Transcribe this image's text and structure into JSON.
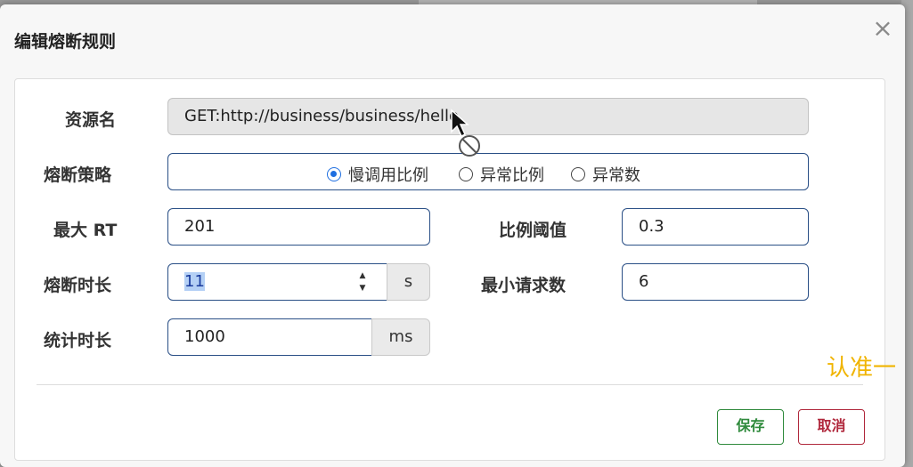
{
  "dialog": {
    "title": "编辑熔断规则",
    "close_symbol": "×"
  },
  "form": {
    "resource_label": "资源名",
    "resource_value": "GET:http://business/business/hello",
    "strategy_label": "熔断策略",
    "strategy_options": [
      {
        "label": "慢调用比例",
        "selected": true
      },
      {
        "label": "异常比例",
        "selected": false
      },
      {
        "label": "异常数",
        "selected": false
      }
    ],
    "max_rt_label": "最大 RT",
    "max_rt_value": "201",
    "ratio_threshold_label": "比例阈值",
    "ratio_threshold_value": "0.3",
    "break_duration_label": "熔断时长",
    "break_duration_value": "11",
    "break_duration_unit": "s",
    "min_request_label": "最小请求数",
    "min_request_value": "6",
    "stat_duration_label": "统计时长",
    "stat_duration_value": "1000",
    "stat_duration_unit": "ms"
  },
  "footer": {
    "save_label": "保存",
    "cancel_label": "取消"
  },
  "watermark": "认准一",
  "colors": {
    "input_border": "#2a4f86",
    "save": "#2f8a3c",
    "cancel": "#b0283c",
    "radio_selected": "#1f6fe0",
    "watermark": "#f0b400"
  }
}
